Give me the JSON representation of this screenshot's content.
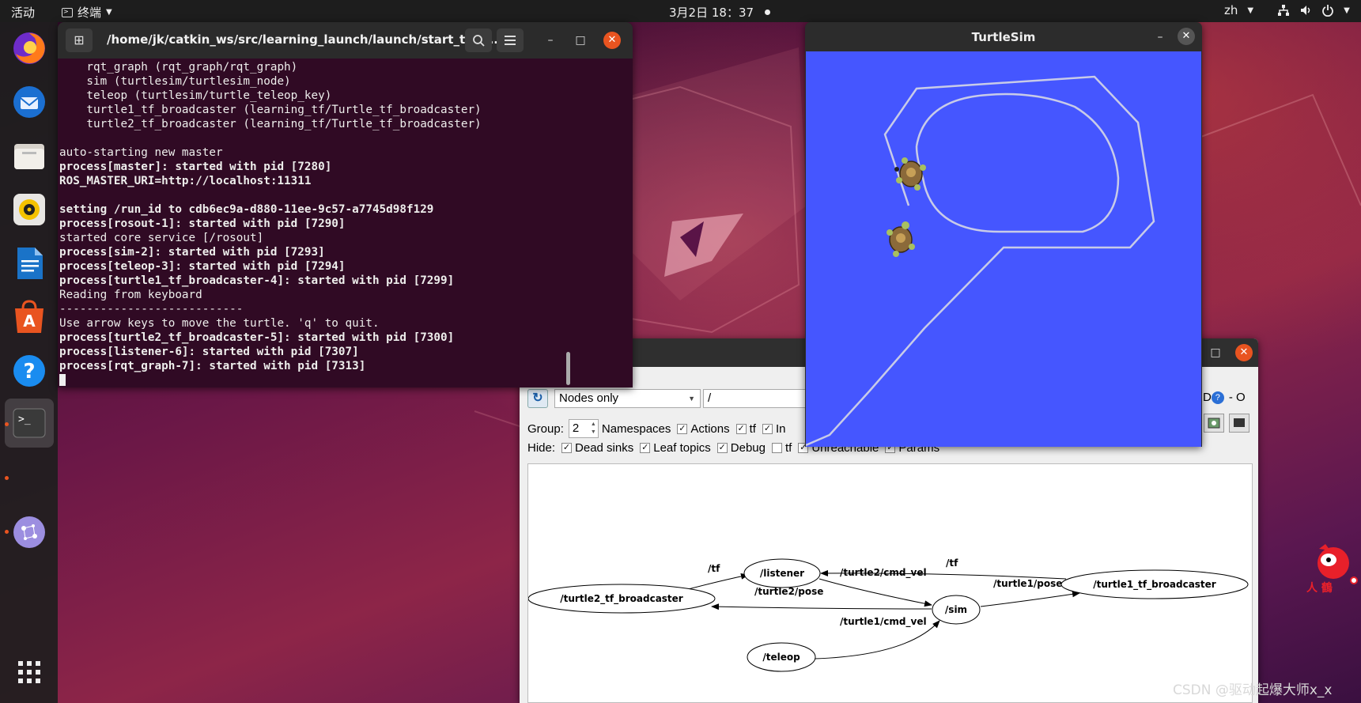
{
  "topbar": {
    "activities": "活动",
    "app_name": "终端",
    "clock": "3月2日  18：37",
    "input_method": "zh"
  },
  "terminal": {
    "title": "/home/jk/catkin_ws/src/learning_launch/launch/start_tf_d...",
    "lines": [
      {
        "text": "    rqt_graph (rqt_graph/rqt_graph)",
        "bold": false
      },
      {
        "text": "    sim (turtlesim/turtlesim_node)",
        "bold": false
      },
      {
        "text": "    teleop (turtlesim/turtle_teleop_key)",
        "bold": false
      },
      {
        "text": "    turtle1_tf_broadcaster (learning_tf/Turtle_tf_broadcaster)",
        "bold": false
      },
      {
        "text": "    turtle2_tf_broadcaster (learning_tf/Turtle_tf_broadcaster)",
        "bold": false
      },
      {
        "text": "",
        "bold": false
      },
      {
        "text": "auto-starting new master",
        "bold": false
      },
      {
        "text": "process[master]: started with pid [7280]",
        "bold": true
      },
      {
        "text": "ROS_MASTER_URI=http://localhost:11311",
        "bold": true
      },
      {
        "text": "",
        "bold": false
      },
      {
        "text": "setting /run_id to cdb6ec9a-d880-11ee-9c57-a7745d98f129",
        "bold": true
      },
      {
        "text": "process[rosout-1]: started with pid [7290]",
        "bold": true
      },
      {
        "text": "started core service [/rosout]",
        "bold": false
      },
      {
        "text": "process[sim-2]: started with pid [7293]",
        "bold": true
      },
      {
        "text": "process[teleop-3]: started with pid [7294]",
        "bold": true
      },
      {
        "text": "process[turtle1_tf_broadcaster-4]: started with pid [7299]",
        "bold": true
      },
      {
        "text": "Reading from keyboard",
        "bold": false
      },
      {
        "text": "---------------------------",
        "bold": false
      },
      {
        "text": "Use arrow keys to move the turtle. 'q' to quit.",
        "bold": false
      },
      {
        "text": "process[turtle2_tf_broadcaster-5]: started with pid [7300]",
        "bold": true
      },
      {
        "text": "process[listener-6]: started with pid [7307]",
        "bold": true
      },
      {
        "text": "process[rqt_graph-7]: started with pid [7313]",
        "bold": true
      }
    ]
  },
  "turtlesim": {
    "title": "TurtleSim",
    "background_color": "#4556ff"
  },
  "rqt": {
    "mode_select": "Nodes only",
    "filter_value": "/",
    "group_label": "Group:",
    "group_value": "2",
    "row1": [
      {
        "label": "Namespaces",
        "checked": true
      },
      {
        "label": "Actions",
        "checked": true
      },
      {
        "label": "tf",
        "checked": true
      },
      {
        "label": "In",
        "checked": true
      }
    ],
    "hide_label": "Hide:",
    "row2": [
      {
        "label": "Dead sinks",
        "checked": true
      },
      {
        "label": "Leaf topics",
        "checked": true
      },
      {
        "label": "Debug",
        "checked": true
      },
      {
        "label": "tf",
        "checked": false
      },
      {
        "label": "Unreachable",
        "checked": true
      },
      {
        "label": "Params",
        "checked": true
      }
    ],
    "right_fragment": "D",
    "right_fragment2": "- O",
    "nodes": {
      "listener": "/listener",
      "turtle2_tf": "/turtle2_tf_broadcaster",
      "sim": "/sim",
      "turtle1_tf": "/turtle1_tf_broadcaster",
      "teleop": "/teleop"
    },
    "edges": {
      "tf_a": "/tf",
      "tf_b": "/tf",
      "turtle2_cmd_vel": "/turtle2/cmd_vel",
      "turtle2_pose": "/turtle2/pose",
      "turtle1_pose": "/turtle1/pose",
      "turtle1_cmd_vel": "/turtle1/cmd_vel"
    }
  },
  "watermark": "CSDN @驱动起爆大师x_x"
}
